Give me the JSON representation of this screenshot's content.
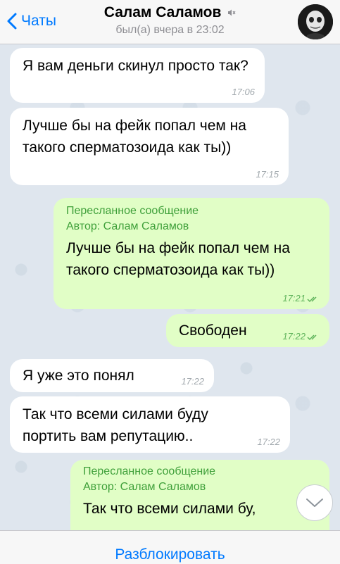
{
  "header": {
    "back_label": "Чаты",
    "title": "Салам Саламов",
    "status": "был(а) вчера в 23:02"
  },
  "messages": [
    {
      "direction": "in",
      "text": "Я вам деньги скинул просто так?",
      "time": "17:06"
    },
    {
      "direction": "in",
      "text": "Лучше бы на фейк попал чем на такого сперматозоида как ты))",
      "time": "17:15"
    },
    {
      "direction": "out",
      "forward_label": "Пересланное сообщение",
      "forward_author": "Автор: Салам Саламов",
      "text": "Лучше бы на фейк попал чем на такого сперматозоида как ты))",
      "time": "17:21",
      "read": true
    },
    {
      "direction": "out",
      "text": "Свободен",
      "time": "17:22",
      "read": true
    },
    {
      "direction": "in",
      "text": "Я уже это понял",
      "time": "17:22"
    },
    {
      "direction": "in",
      "text": "Так что всеми силами буду портить вам репутацию..",
      "time": "17:22"
    },
    {
      "direction": "out",
      "forward_label": "Пересланное сообщение",
      "forward_author": "Автор: Салам Саламов",
      "text": "Так что всеми силами бу,"
    }
  ],
  "footer": {
    "unblock_label": "Разблокировать"
  },
  "colors": {
    "accent": "#007aff",
    "outgoing_bubble": "#e1fec6",
    "incoming_bubble": "#ffffff",
    "forward_text": "#3fa03a"
  },
  "icons": {
    "back": "chevron-left-icon",
    "mute": "mute-icon",
    "read": "double-check-icon",
    "scroll": "chevron-down-icon"
  }
}
